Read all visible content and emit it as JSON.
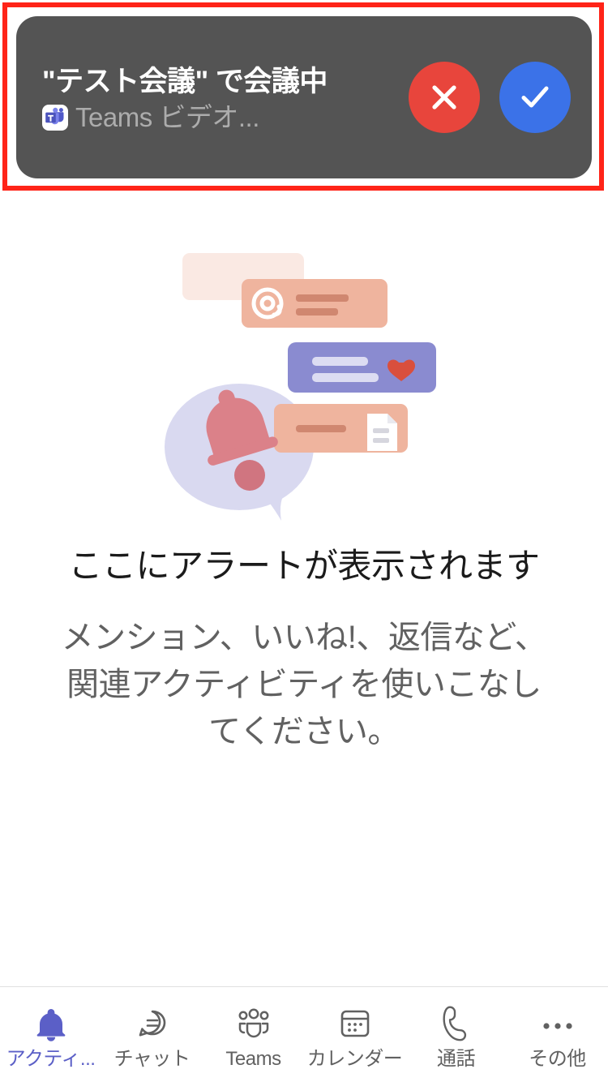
{
  "app": {
    "name": "Microsoft Teams",
    "accent_color": "#5B5FC7"
  },
  "annotation": {
    "name": "highlight-rectangle",
    "color": "#FF2418",
    "target": "incoming-meeting-banner"
  },
  "banner": {
    "title": "\"テスト会議\" で会議中",
    "subtitle": "Teams ビデオ...",
    "app_icon": "teams-app-icon",
    "background_color": "#545454",
    "decline": {
      "label": "×",
      "icon": "close-icon",
      "color": "#E8453C"
    },
    "accept": {
      "label": "✓",
      "icon": "checkmark-icon",
      "color": "#3B72E8"
    }
  },
  "empty_state": {
    "illustration": "activity-notifications-illustration",
    "title": "ここにアラートが表示されます",
    "description": "メンション、いいね!、返信など、関連アクティビティを使いこなしてください。",
    "illustration_colors": {
      "card_faint": "#FAE9E3",
      "card_salmon": "#EFB49E",
      "card_purple": "#8A8BD0",
      "bar_salmon": "#D08770",
      "bar_lavender": "#DCDCF2",
      "heart": "#D94F3D",
      "bubble": "#D9D9F0",
      "bell": "#DB8189",
      "bell_clapper": "#CF6C76",
      "document": "#FFFFFF"
    }
  },
  "tab_bar": {
    "items": [
      {
        "label": "アクティ...",
        "icon": "bell-icon",
        "active": true
      },
      {
        "label": "チャット",
        "icon": "chat-bubble-icon",
        "active": false
      },
      {
        "label": "Teams",
        "icon": "people-team-icon",
        "active": false
      },
      {
        "label": "カレンダー",
        "icon": "calendar-icon",
        "active": false
      },
      {
        "label": "通話",
        "icon": "phone-icon",
        "active": false
      },
      {
        "label": "その他",
        "icon": "more-horizontal-icon",
        "active": false
      }
    ]
  }
}
